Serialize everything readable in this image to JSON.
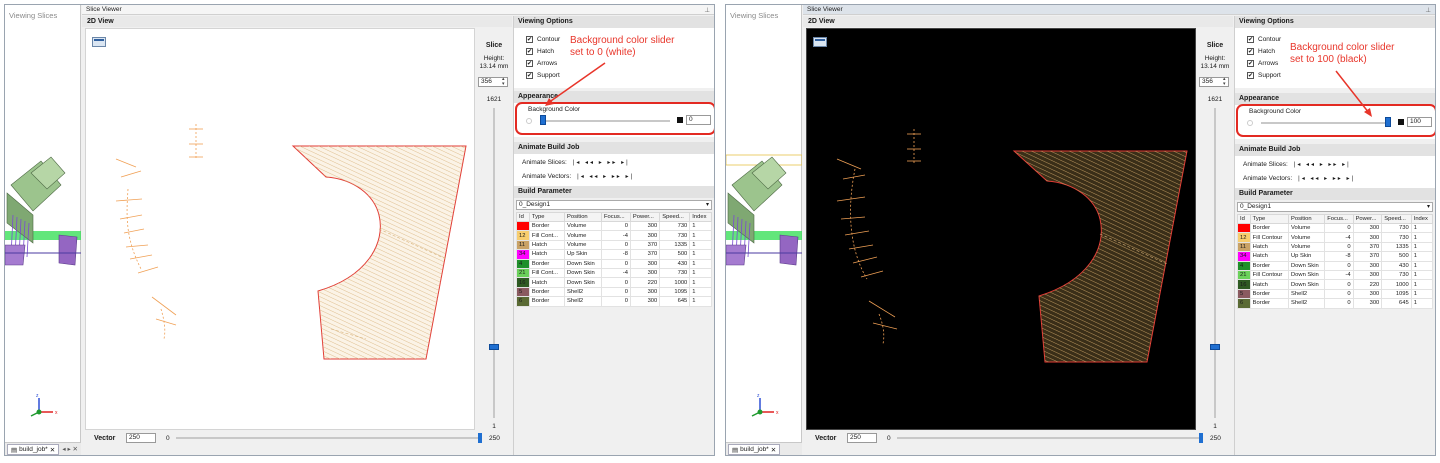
{
  "panes": [
    {
      "viewing_slices_title": "Viewing Slices",
      "tab_label": "build_job*",
      "slice_viewer_title": "Slice Viewer",
      "view_title": "2D View",
      "slice": {
        "label": "Slice",
        "height_label": "Height:",
        "height_value": "13.14 mm",
        "value": "356",
        "max": "1621",
        "min": "1"
      },
      "vector": {
        "label": "Vector",
        "value": "250",
        "min": "0",
        "max": "250"
      },
      "viewing_options": {
        "title": "Viewing Options",
        "items": [
          "Contour",
          "Hatch",
          "Arrows",
          "Support"
        ]
      },
      "appearance": {
        "title": "Appearance",
        "bg_label": "Background Color",
        "bg_value": "0",
        "bg_level_percent": 0
      },
      "animate": {
        "title": "Animate Build Job",
        "slices_label": "Animate Slices:",
        "vectors_label": "Animate Vectors:",
        "controls": "|◂ ◂◂ ▸ ▸▸ ▸|"
      },
      "build_parameter": {
        "title": "Build Parameter",
        "selected": "0_Design1"
      },
      "table": {
        "headers": [
          "Id",
          "Type",
          "Position",
          "Focus...",
          "Power...",
          "Speed...",
          "Index"
        ],
        "rows": [
          {
            "color": "#ff0000",
            "id": "",
            "type": "Border",
            "position": "Volume",
            "focus": "0",
            "power": "300",
            "speed": "730",
            "index": "1"
          },
          {
            "color": "#f7cd6e",
            "id": "12",
            "type": "Fill Cont...",
            "position": "Volume",
            "focus": "-4",
            "power": "300",
            "speed": "730",
            "index": "1"
          },
          {
            "color": "#c9a266",
            "id": "11",
            "type": "Hatch",
            "position": "Volume",
            "focus": "0",
            "power": "370",
            "speed": "1335",
            "index": "1"
          },
          {
            "color": "#ff00ff",
            "id": "34",
            "type": "Hatch",
            "position": "Up Skin",
            "focus": "-8",
            "power": "370",
            "speed": "500",
            "index": "1"
          },
          {
            "color": "#1f8f2a",
            "id": "4",
            "type": "Border",
            "position": "Down Skin",
            "focus": "0",
            "power": "300",
            "speed": "430",
            "index": "1"
          },
          {
            "color": "#6bd15a",
            "id": "21",
            "type": "Fill Cont...",
            "position": "Down Skin",
            "focus": "-4",
            "power": "300",
            "speed": "730",
            "index": "1"
          },
          {
            "color": "#2e5a22",
            "id": "16",
            "type": "Hatch",
            "position": "Down Skin",
            "focus": "0",
            "power": "220",
            "speed": "1000",
            "index": "1"
          },
          {
            "color": "#8a5a60",
            "id": "5",
            "type": "Border",
            "position": "Shell2",
            "focus": "0",
            "power": "300",
            "speed": "1095",
            "index": "1"
          },
          {
            "color": "#5a6a34",
            "id": "6",
            "type": "Border",
            "position": "Shell2",
            "focus": "0",
            "power": "300",
            "speed": "645",
            "index": "1"
          }
        ]
      },
      "callout": {
        "line1": "Background color slider",
        "line2": "set to 0 (white)"
      },
      "canvas_bg": "#ffffff"
    },
    {
      "viewing_slices_title": "Viewing Slices",
      "tab_label": "build_job*",
      "slice_viewer_title": "Slice Viewer",
      "view_title": "2D View",
      "slice": {
        "label": "Slice",
        "height_label": "Height:",
        "height_value": "13.14 mm",
        "value": "356",
        "max": "1621",
        "min": "1"
      },
      "vector": {
        "label": "Vector",
        "value": "250",
        "min": "0",
        "max": "250"
      },
      "viewing_options": {
        "title": "Viewing Options",
        "items": [
          "Contour",
          "Hatch",
          "Arrows",
          "Support"
        ]
      },
      "appearance": {
        "title": "Appearance",
        "bg_label": "Background Color",
        "bg_value": "100",
        "bg_level_percent": 100
      },
      "animate": {
        "title": "Animate Build Job",
        "slices_label": "Animate Slices:",
        "vectors_label": "Animate Vectors:",
        "controls": "|◂ ◂◂ ▸ ▸▸ ▸|"
      },
      "build_parameter": {
        "title": "Build Parameter",
        "selected": "0_Design1"
      },
      "table": {
        "headers": [
          "Id",
          "Type",
          "Position",
          "Focus...",
          "Power...",
          "Speed...",
          "Index"
        ],
        "rows": [
          {
            "color": "#ff0000",
            "id": "",
            "type": "Border",
            "position": "Volume",
            "focus": "0",
            "power": "300",
            "speed": "730",
            "index": "1"
          },
          {
            "color": "#f7cd6e",
            "id": "12",
            "type": "Fill Contour",
            "position": "Volume",
            "focus": "-4",
            "power": "300",
            "speed": "730",
            "index": "1"
          },
          {
            "color": "#c9a266",
            "id": "11",
            "type": "Hatch",
            "position": "Volume",
            "focus": "0",
            "power": "370",
            "speed": "1335",
            "index": "1"
          },
          {
            "color": "#ff00ff",
            "id": "34",
            "type": "Hatch",
            "position": "Up Skin",
            "focus": "-8",
            "power": "370",
            "speed": "500",
            "index": "1"
          },
          {
            "color": "#1f8f2a",
            "id": "4",
            "type": "Border",
            "position": "Down Skin",
            "focus": "0",
            "power": "300",
            "speed": "430",
            "index": "1"
          },
          {
            "color": "#6bd15a",
            "id": "21",
            "type": "Fill Contour",
            "position": "Down Skin",
            "focus": "-4",
            "power": "300",
            "speed": "730",
            "index": "1"
          },
          {
            "color": "#2e5a22",
            "id": "16",
            "type": "Hatch",
            "position": "Down Skin",
            "focus": "0",
            "power": "220",
            "speed": "1000",
            "index": "1"
          },
          {
            "color": "#8a5a60",
            "id": "5",
            "type": "Border",
            "position": "Shell2",
            "focus": "0",
            "power": "300",
            "speed": "1095",
            "index": "1"
          },
          {
            "color": "#5a6a34",
            "id": "6",
            "type": "Border",
            "position": "Shell2",
            "focus": "0",
            "power": "300",
            "speed": "645",
            "index": "1"
          }
        ]
      },
      "callout": {
        "line1": "Background color slider",
        "line2": "set to 100 (black)"
      },
      "canvas_bg": "#000000"
    }
  ],
  "colors": {
    "accent": "#1f6fd1",
    "callout": "#e8352a",
    "part_outline": "#e23b35",
    "hatch": "#d9b37a",
    "support": "#f0a055"
  }
}
